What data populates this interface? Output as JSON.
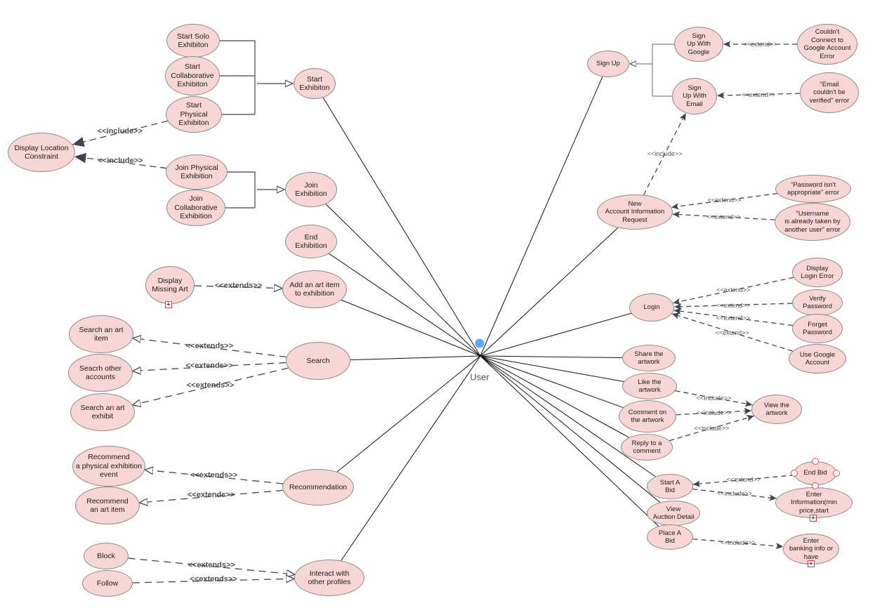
{
  "diagram": {
    "type": "use-case",
    "actor": {
      "label": "User",
      "color": "#5ea8f5"
    },
    "colors": {
      "use_case_fill": "#f9d6d6",
      "use_case_border": "#8a8a8a",
      "line": "#3d4450",
      "handle": "#e44b55"
    },
    "use_cases": [
      {
        "id": "start_solo",
        "label": "Start Solo\nExhibiton"
      },
      {
        "id": "start_collab",
        "label": "Start\nCollaborative\nExhibiton"
      },
      {
        "id": "start_physical",
        "label": "Start\nPhysical\nExhibiton"
      },
      {
        "id": "start_exhibition",
        "label": "Start\nExhibiton"
      },
      {
        "id": "display_location",
        "label": "Display Location\nConstraint"
      },
      {
        "id": "join_physical",
        "label": "Join Physical\nExhibition"
      },
      {
        "id": "join_collab",
        "label": "Join\nCollaborative\nExhibition"
      },
      {
        "id": "join_exhibition",
        "label": "Join\nExhibition"
      },
      {
        "id": "end_exhibition",
        "label": "End\nExhibition"
      },
      {
        "id": "display_missing",
        "label": "Display\nMissing Art"
      },
      {
        "id": "add_art",
        "label": "Add an art item\nto exhibition"
      },
      {
        "id": "search_art_item",
        "label": "Search an art\nitem"
      },
      {
        "id": "search_accounts",
        "label": "Seacrh other\naccounts"
      },
      {
        "id": "search_exhibit",
        "label": "Search an art\nexhibit"
      },
      {
        "id": "search",
        "label": "Search"
      },
      {
        "id": "rec_physical",
        "label": "Recommend\na physical exhibition\nevent"
      },
      {
        "id": "rec_art",
        "label": "Recommend\nan art item"
      },
      {
        "id": "recommendation",
        "label": "Recommendation"
      },
      {
        "id": "block",
        "label": "Block"
      },
      {
        "id": "follow",
        "label": "Follow"
      },
      {
        "id": "interact",
        "label": "Interact with\nother profiles"
      },
      {
        "id": "sign_up",
        "label": "Sign Up"
      },
      {
        "id": "signup_google",
        "label": "Sign\nUp With\nGoogle"
      },
      {
        "id": "signup_email",
        "label": "Sign\nUp With\nEmail"
      },
      {
        "id": "google_error",
        "label": "Couldn't\nConnect to\nGoogle Account\nError"
      },
      {
        "id": "email_error",
        "label": "\"Email\ncouldn't be\nverified\" error"
      },
      {
        "id": "new_account",
        "label": "New\nAccount Information\nRequest"
      },
      {
        "id": "password_error",
        "label": "\"Password isn't\nappropriate\" error"
      },
      {
        "id": "username_error",
        "label": "\"Username\nis already taken by\nanother user\" error"
      },
      {
        "id": "login",
        "label": "Login"
      },
      {
        "id": "login_error",
        "label": "Display\nLogin Error"
      },
      {
        "id": "verify_password",
        "label": "Verify\nPassword"
      },
      {
        "id": "forget_password",
        "label": "Forget\nPassword"
      },
      {
        "id": "use_google",
        "label": "Use Google\nAccount"
      },
      {
        "id": "share",
        "label": "Share the\nartwork"
      },
      {
        "id": "like",
        "label": "Like the\nartwork"
      },
      {
        "id": "comment",
        "label": "Comment on\nthe artwork"
      },
      {
        "id": "reply",
        "label": "Reply to a\ncomment"
      },
      {
        "id": "view_artwork",
        "label": "View the\nartwork"
      },
      {
        "id": "start_bid",
        "label": "Start A\nBid"
      },
      {
        "id": "view_auction",
        "label": "View\nAuction Detail"
      },
      {
        "id": "place_bid",
        "label": "Place A\nBid"
      },
      {
        "id": "end_bid",
        "label": "End Bid"
      },
      {
        "id": "enter_info",
        "label": "Enter\nInformation(min\nprice,start"
      },
      {
        "id": "enter_banking",
        "label": "Enter\nbanking info or\nhave"
      }
    ],
    "relations": [
      {
        "from": "display_location",
        "to": "start_physical",
        "label": "<<include>>"
      },
      {
        "from": "display_location",
        "to": "join_physical",
        "label": "<<include>>"
      },
      {
        "from": "display_missing",
        "to": "add_art",
        "label": "<<extends>>"
      },
      {
        "from": "search",
        "to": "search_art_item",
        "label": "<<extends>>"
      },
      {
        "from": "search",
        "to": "search_accounts",
        "label": "<<extends>>"
      },
      {
        "from": "search",
        "to": "search_exhibit",
        "label": "<<extends>>"
      },
      {
        "from": "recommendation",
        "to": "rec_physical",
        "label": "<<extends>>"
      },
      {
        "from": "recommendation",
        "to": "rec_art",
        "label": "<<extends>>"
      },
      {
        "from": "block",
        "to": "interact",
        "label": "<<extends>>"
      },
      {
        "from": "follow",
        "to": "interact",
        "label": "<<extends>>"
      },
      {
        "from": "google_error",
        "to": "signup_google",
        "label": "<<extend>>"
      },
      {
        "from": "email_error",
        "to": "signup_email",
        "label": "<<extend>>"
      },
      {
        "from": "new_account",
        "to": "signup_email",
        "label": "<<include>>"
      },
      {
        "from": "password_error",
        "to": "new_account",
        "label": "<<extend>>"
      },
      {
        "from": "username_error",
        "to": "new_account",
        "label": "<<extend>>"
      },
      {
        "from": "login_error",
        "to": "login",
        "label": "<<extend>>"
      },
      {
        "from": "verify_password",
        "to": "login",
        "label": "<<extend>>"
      },
      {
        "from": "forget_password",
        "to": "login",
        "label": "<<extend>>"
      },
      {
        "from": "use_google",
        "to": "login",
        "label": "<<extend>>"
      },
      {
        "from": "like",
        "to": "view_artwork",
        "label": "<<include>>"
      },
      {
        "from": "comment",
        "to": "view_artwork",
        "label": "<<include>>"
      },
      {
        "from": "reply",
        "to": "view_artwork",
        "label": "<<include>>"
      },
      {
        "from": "end_bid",
        "to": "start_bid",
        "label": "<<extend>>"
      },
      {
        "from": "start_bid",
        "to": "enter_info",
        "label": "<<include>>"
      },
      {
        "from": "place_bid",
        "to": "enter_banking",
        "label": "<<include>>"
      }
    ]
  }
}
